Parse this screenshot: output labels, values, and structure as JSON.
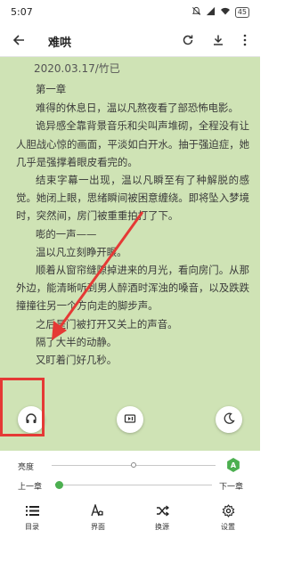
{
  "status_bar": {
    "time": "5:07",
    "battery": "45"
  },
  "app_bar": {
    "title": "难哄",
    "back_icon": "back-arrow-icon",
    "refresh_icon": "refresh-icon",
    "download_icon": "download-icon",
    "more_icon": "more-vert-icon"
  },
  "reader": {
    "background_color": "#cfe3b5",
    "chapter_header": "2020.03.17/竹已",
    "chapter_title": "第一章",
    "paragraphs": [
      "难得的休息日，温以凡熬夜看了部恐怖电影。",
      "诡异感全靠背景音乐和尖叫声堆砌，全程没有让人胆战心惊的画面，平淡如白开水。抽于强迫症，她几乎是强撑着眼皮看完的。",
      "结束字幕一出现，温以凡瞬至有了种解脱的感觉。她闭上眼，思绪瞬间被困意缠绕。即将坠入梦境时，突然间，房门被重重拍打了下。",
      "嘭的一声——",
      "温以凡立刻睁开眼。",
      "顺着从窗帘缝隙掉进来的月光，看向房门。从那外边，能清晰听到男人醉酒时浑浊的嗓音，以及跌跌撞撞往另一个方向走的脚步声。",
      "之后是门被打开又关上的声音。",
      "隔了大半的动静。",
      "又盯着门好几秒。"
    ],
    "fab_listen_icon": "headphones-icon",
    "fab_autopage_icon": "auto-page-icon",
    "fab_night_icon": "moon-icon"
  },
  "annotation": {
    "color": "#e53935"
  },
  "panel": {
    "brightness_label": "亮度",
    "brightness_level": 0.5,
    "auto_badge": "A",
    "prev_chapter": "上一章",
    "next_chapter": "下一章",
    "progress": 0.02,
    "accent_color": "#4caf50",
    "tools": [
      {
        "label": "目录",
        "icon": "toc-icon"
      },
      {
        "label": "界面",
        "icon": "font-icon"
      },
      {
        "label": "换源",
        "icon": "shuffle-icon"
      },
      {
        "label": "设置",
        "icon": "settings-icon"
      }
    ]
  }
}
